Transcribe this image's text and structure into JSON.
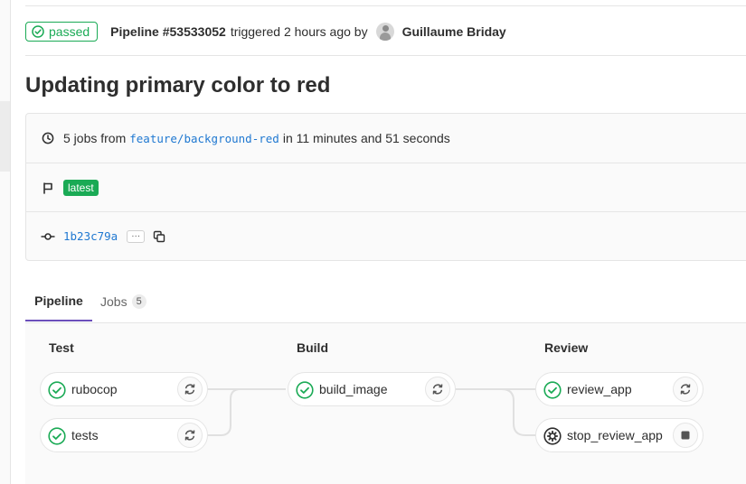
{
  "header": {
    "status": "passed",
    "pipeline_id": "Pipeline #53533052",
    "triggered_text": "triggered 2 hours ago by",
    "author": "Guillaume Briday"
  },
  "title": "Updating primary color to red",
  "info": {
    "jobs_prefix": "5 jobs from",
    "branch": "feature/background-red",
    "duration_text": "in 11 minutes and 51 seconds",
    "badge": "latest",
    "commit_sha": "1b23c79a",
    "ellipsis": "···"
  },
  "tabs": [
    {
      "label": "Pipeline"
    },
    {
      "label": "Jobs",
      "count": "5"
    }
  ],
  "stages": [
    {
      "title": "Test",
      "jobs": [
        {
          "name": "rubocop",
          "status": "success",
          "action": "retry"
        },
        {
          "name": "tests",
          "status": "success",
          "action": "retry"
        }
      ]
    },
    {
      "title": "Build",
      "jobs": [
        {
          "name": "build_image",
          "status": "success",
          "action": "retry"
        }
      ]
    },
    {
      "title": "Review",
      "jobs": [
        {
          "name": "review_app",
          "status": "success",
          "action": "retry"
        },
        {
          "name": "stop_review_app",
          "status": "manual",
          "action": "stop"
        }
      ]
    }
  ],
  "colors": {
    "success": "#1aaa55",
    "link": "#1f78d1",
    "tab_active": "#6b4fbb",
    "text": "#2e2e2e"
  },
  "icons": {
    "status": "check-circle-icon",
    "duration": "clock-icon",
    "badge": "flag-icon",
    "commit": "commit-icon",
    "copy": "copy-icon",
    "retry": "retry-icon",
    "manual": "gear-icon",
    "stop": "stop-icon"
  }
}
